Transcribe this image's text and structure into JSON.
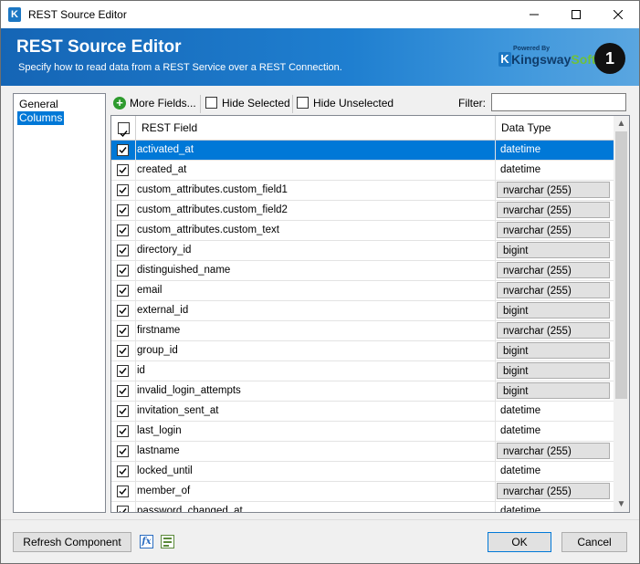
{
  "window": {
    "title": "REST Source Editor"
  },
  "header": {
    "title": "REST Source Editor",
    "subtitle": "Specify how to read data from a REST Service over a REST Connection.",
    "logo": {
      "powered_by": "Powered By",
      "brand_first": "Kingsway",
      "brand_second": "Soft"
    },
    "badge_text": "1"
  },
  "nav": {
    "items": [
      {
        "label": "General"
      },
      {
        "label": "Columns"
      }
    ]
  },
  "toolbar": {
    "more_fields": "More Fields...",
    "hide_selected": "Hide Selected",
    "hide_unselected": "Hide Unselected",
    "filter_label": "Filter:",
    "filter_value": ""
  },
  "grid": {
    "headers": {
      "field": "REST Field",
      "type": "Data Type"
    },
    "rows": [
      {
        "field": "activated_at",
        "type": "datetime",
        "editable": false,
        "selected": true
      },
      {
        "field": "created_at",
        "type": "datetime",
        "editable": false
      },
      {
        "field": "custom_attributes.custom_field1",
        "type": "nvarchar (255)",
        "editable": true
      },
      {
        "field": "custom_attributes.custom_field2",
        "type": "nvarchar (255)",
        "editable": true
      },
      {
        "field": "custom_attributes.custom_text",
        "type": "nvarchar (255)",
        "editable": true
      },
      {
        "field": "directory_id",
        "type": "bigint",
        "editable": true
      },
      {
        "field": "distinguished_name",
        "type": "nvarchar (255)",
        "editable": true
      },
      {
        "field": "email",
        "type": "nvarchar (255)",
        "editable": true
      },
      {
        "field": "external_id",
        "type": "bigint",
        "editable": true
      },
      {
        "field": "firstname",
        "type": "nvarchar (255)",
        "editable": true
      },
      {
        "field": "group_id",
        "type": "bigint",
        "editable": true
      },
      {
        "field": "id",
        "type": "bigint",
        "editable": true
      },
      {
        "field": "invalid_login_attempts",
        "type": "bigint",
        "editable": true
      },
      {
        "field": "invitation_sent_at",
        "type": "datetime",
        "editable": false
      },
      {
        "field": "last_login",
        "type": "datetime",
        "editable": false
      },
      {
        "field": "lastname",
        "type": "nvarchar (255)",
        "editable": true
      },
      {
        "field": "locked_until",
        "type": "datetime",
        "editable": false
      },
      {
        "field": "member_of",
        "type": "nvarchar (255)",
        "editable": true
      },
      {
        "field": "password_changed_at",
        "type": "datetime",
        "editable": false
      }
    ]
  },
  "footer": {
    "refresh": "Refresh Component",
    "ok": "OK",
    "cancel": "Cancel"
  },
  "colors": {
    "accent": "#0078d7",
    "header_start": "#1565b5",
    "header_end": "#5aa6e0"
  }
}
